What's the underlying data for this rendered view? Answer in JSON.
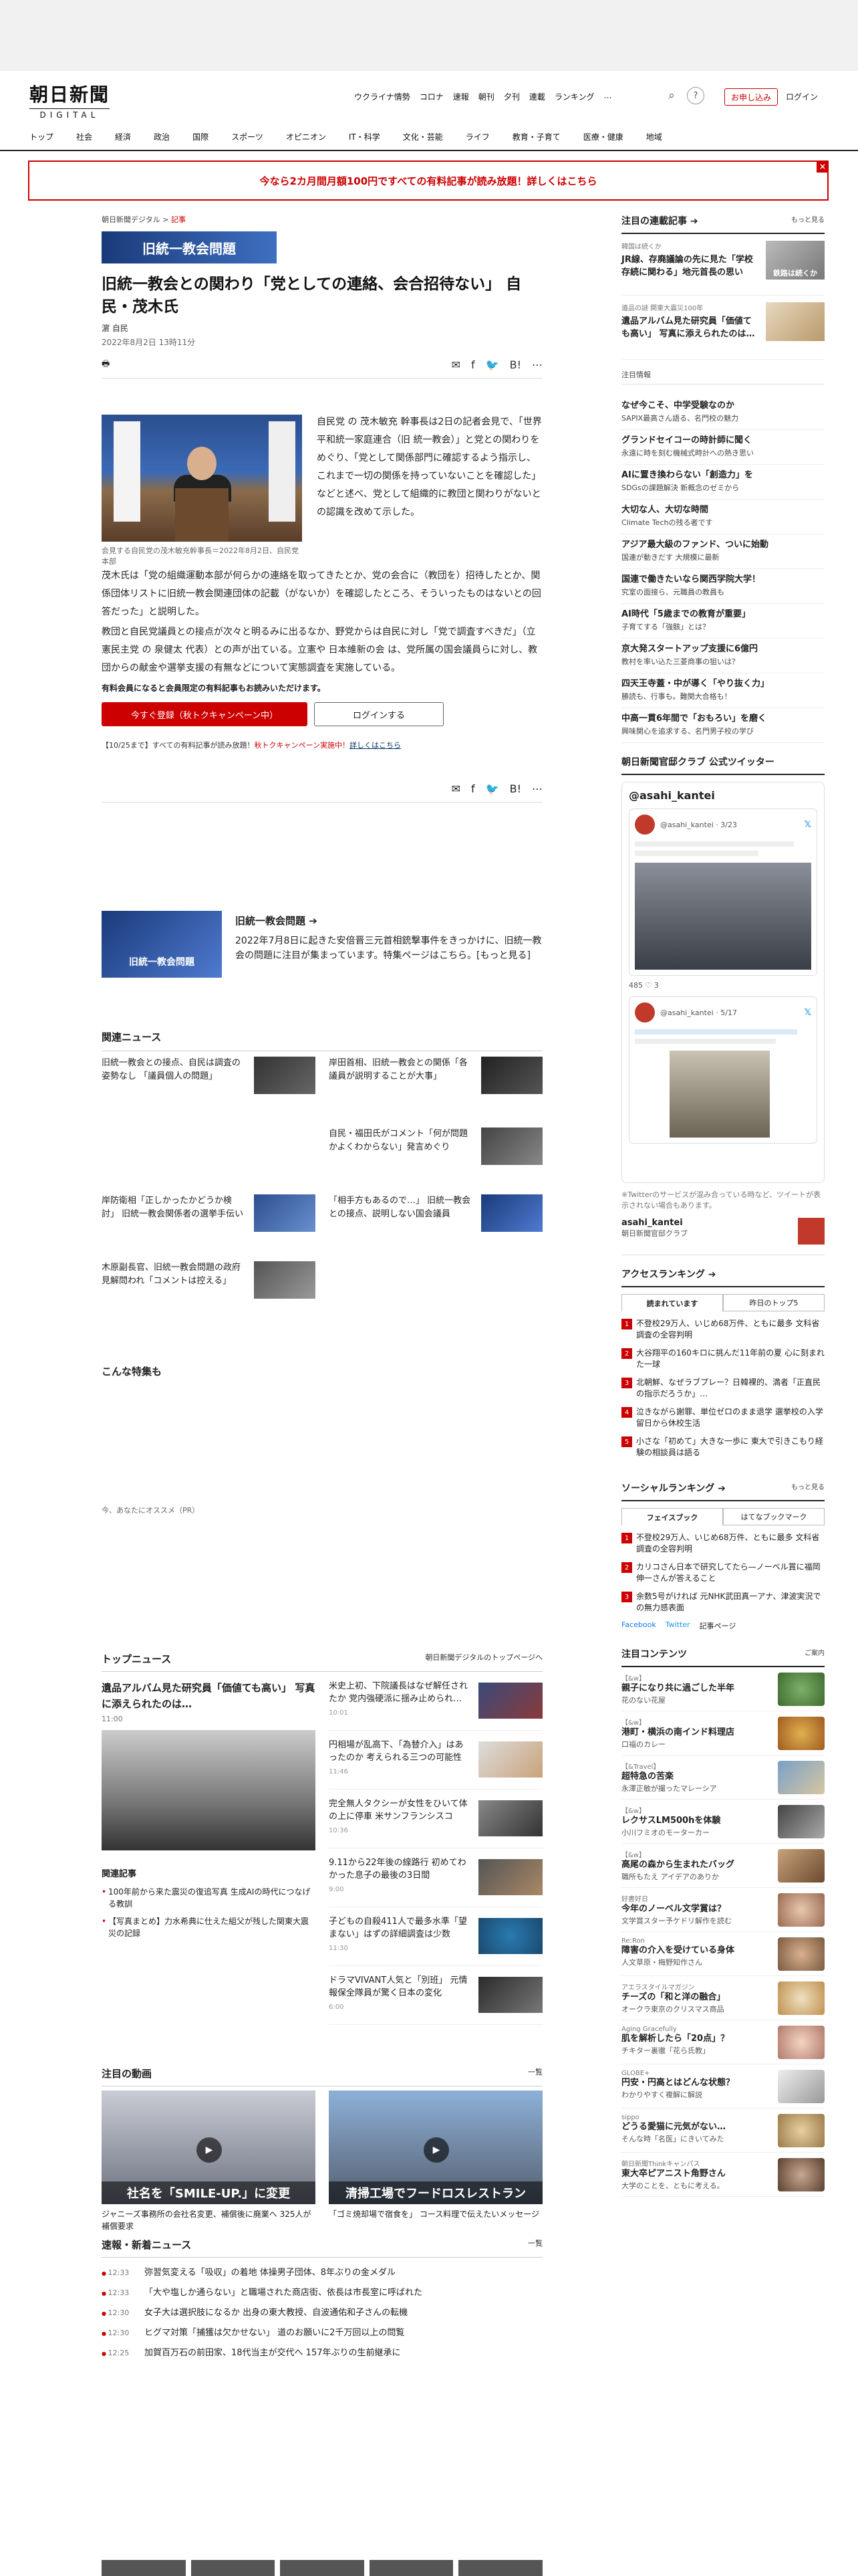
{
  "header": {
    "logo_ja": "朝日新聞",
    "logo_en": "DIGITAL",
    "topnav": [
      "ウクライナ情勢",
      "コロナ",
      "速報",
      "朝刊",
      "夕刊",
      "連載",
      "ランキング"
    ],
    "more": "…",
    "subscribe": "お申し込み",
    "login": "ログイン"
  },
  "catnav": [
    "トップ",
    "社会",
    "経済",
    "政治",
    "国際",
    "スポーツ",
    "オピニオン",
    "IT・科学",
    "文化・芸能",
    "ライフ",
    "教育・子育て",
    "医療・健康",
    "地域"
  ],
  "banner": {
    "text": "今なら2カ月間月額100円ですべての有料記事が読み放題！詳しくはこちら",
    "close": "×"
  },
  "article": {
    "breadcrumb": [
      "朝日新聞デジタル",
      "記事"
    ],
    "bc_sep": ">",
    "tag": "旧統一教会問題",
    "title": "旧統一教会との関わり「党としての連絡、会合招待ない」 自民・茂木氏",
    "author": "濵 自民",
    "date": "2022年8月2日 13時11分",
    "share_counts": {
      "list": "list",
      "one": "1"
    },
    "caption": "会見する自民党の茂木敏充幹事長＝2022年8月2日、自民党本部",
    "p1": "自民党 の 茂木敏充 幹事長は2日の記者会見で、「世界平和統一家庭連合（旧 統一教会）」と党との関わりをめぐり、「党として関係部門に確認するよう指示し、これまで一切の関係を持っていないことを確認した」などと述べ、党として組織的に教団と関わりがないとの認識を改めて示した。",
    "p2": "茂木氏は「党の組織運動本部が何らかの連絡を取ってきたとか、党の会合に（教団を）招待したとか、関係団体リストに旧統一教会関連団体の記載（がないか）を確認したところ、そういったものはないとの回答だった」と説明した。",
    "p3": "教団と自民党議員との接点が次々と明るみに出るなか、野党からは自民に対し「党で調査すべきだ」（立憲民主党 の 泉健太 代表）との声が出ている。立憲や 日本維新の会 は、党所属の国会議員らに対し、教団からの献金や選挙支援の有無などについて実態調査を実施している。",
    "member_text": "有料会員になると会員限定の有料記事もお読みいただけます。",
    "register": "今すぐ登録（秋トクキャンペーン中）",
    "login": "ログインする",
    "campaign_pre": "【10/25まで】すべての有料記事が読み放題！",
    "campaign_red": "秋トクキャンペーン実施中！",
    "campaign_post": "詳しくはこちら"
  },
  "feature": {
    "img_label": "旧統一教会問題",
    "title": "旧統一教会問題 ➔",
    "text": "2022年7月8日に起きた安倍晋三元首相銃撃事件をきっかけに、旧統一教会の問題に注目が集まっています。特集ページはこちら。[もっと見る]"
  },
  "related": {
    "heading": "関連ニュース",
    "items": [
      "旧統一教会との接点、自民は調査の姿勢なし 「議員個人の問題」",
      "岸田首相、旧統一教会との関係「各議員が説明することが大事」",
      "自民・福田氏がコメント「何が問題かよくわからない」発言めぐり",
      "岸防衛相「正しかったかどうか検討」 旧統一教会関係者の選挙手伝い",
      "「相手方もあるので…」 旧統一教会との接点、説明しない国会議員",
      "木原副長官、旧統一教会問題の政府見解問われ「コメントは控える」"
    ]
  },
  "konna": "こんな特集も",
  "osusume": "今、あなたにオススメ（PR）",
  "topnews": {
    "heading": "トップニュース",
    "link": "朝日新聞デジタルのトップページへ",
    "main_title": "遺品アルバム見た研究員「価値ても高い」 写真に添えられたのは…",
    "main_time": "11:00",
    "related_label": "関連記事",
    "related": [
      "100年前から来た震災の復追写真 生成AIの時代につなげる教訓",
      "【写真まとめ】力水希典に仕えた組父が残した関東大震災の記録"
    ],
    "right": [
      {
        "t": "米史上初、下院議長はなぜ解任されたか 党内強硬派に揺み止められ…",
        "tm": "10:01"
      },
      {
        "t": "円相場が乱高下、「為替介入」はあったのか 考えられる三つの可能性",
        "tm": "11:46"
      },
      {
        "t": "完全無人タクシーが女性をひいて体の上に停車 米サンフランシスコ",
        "tm": "10:36"
      },
      {
        "t": "9.11から22年後の線路行 初めてわかった息子の最後の3日間",
        "tm": "9:00"
      },
      {
        "t": "子どもの自殺411人で最多水準「望まない」はずの詳細調査は少数",
        "tm": "11:30"
      },
      {
        "t": "ドラマVIVANT人気と「別班」 元情報保全隊員が驚く日本の変化",
        "tm": "6:00"
      }
    ]
  },
  "video": {
    "heading": "注目の動画",
    "more": "一覧",
    "items": [
      {
        "cap": "ジャニーズ事務所の会社名変更、補償後に廃業へ 325人が補償要求",
        "overlay": "社名を「SMILE-UP.」に変更"
      },
      {
        "cap": "「ゴミ焼却場で宿食を」 コース料理で伝えたいメッセージ",
        "overlay": "清掃工場でフードロスレストラン"
      }
    ]
  },
  "flash": {
    "heading": "速報・新着ニュース",
    "more": "一覧",
    "items": [
      {
        "tm": "12:33",
        "t": "弥習気変える「吸収」の着地 体操男子団体、8年ぶりの金メダル"
      },
      {
        "tm": "12:33",
        "t": "「大や塩しか通らない」と職場された商店街、依長は市長室に呼ばれた"
      },
      {
        "tm": "12:30",
        "t": "女子大は選択肢になるか 出身の東大教授、自波通佑和子さんの転機"
      },
      {
        "tm": "12:30",
        "t": "ヒグマ対策「捕獲は欠かせない」 道のお願いに2千万回以上の問覧"
      },
      {
        "tm": "12:25",
        "t": "加賀百万石の前田家、18代当主が交代へ 157年ぶりの生前継承に"
      }
    ]
  },
  "side": {
    "chumoku_heading": "注目の連載記事 ➔",
    "more": "もっと見る",
    "chumoku": [
      {
        "sm": "韓国は続くか",
        "t": "JR線、存廃議論の先に見た「学校存続に関わる」地元首長の思い",
        "thumb": "鉄路は続くか"
      },
      {
        "sm": "遺品の謎 関東大震災100年",
        "t": "遺品アルバム見た研究員「価値ても高い」 写真に添えられたのは…"
      }
    ],
    "ad_label": "注目情報",
    "ads": [
      {
        "t": "なぜ今こそ、中学受験なのか",
        "s": "SAPIX最高さん語る、名門校の魅力"
      },
      {
        "t": "グランドセイコーの時計師に聞く",
        "s": "永遠に時を刻む機械式時計への熱き思い"
      },
      {
        "t": "AIに置き換わらない「創造力」を",
        "s": "SDGsの課題解決 新概念のゼミから"
      },
      {
        "t": "大切な人、大切な時間",
        "s": "Climate Techの残る者です"
      },
      {
        "t": "アジア最大級のファンド、ついに始動",
        "s": "国連が動きだす 大規模に最新"
      },
      {
        "t": "国連で働きたいなら関西学院大学！",
        "s": "究室の面接ら、元職員の教員も"
      },
      {
        "t": "AI時代「5歳までの教育が重要」",
        "s": "子育てする「強骸」とは？"
      },
      {
        "t": "京大発スタートアップ支援に6億円",
        "s": "教村を率い込た三菱商事の狙いは？"
      },
      {
        "t": "四天王寺蓋・中が導く「やり抜く力」",
        "s": "勝読も、行事も。難関大合格も！"
      },
      {
        "t": "中高一貫6年間で「おもろい」を磨く",
        "s": "興味関心を追求する、名門男子校の学び"
      }
    ],
    "club_heading": "朝日新聞官邸クラブ 公式ツイッター",
    "tw_title": "@asahi_kantei",
    "tw_handle": "@asahi_kantei · 3/23",
    "tw_handle2": "@asahi_kantei · 5/17",
    "tw_counts": "485 ♡  3",
    "tw_note": "※Twitterのサービスが混み合っている時など、ツイートが表示されない場合もあります。",
    "tw_account": "asahi_kantei",
    "tw_club": "朝日新聞官邸クラブ",
    "access_heading": "アクセスランキング ➔",
    "tabs": [
      "読まれています",
      "昨日のトップ5"
    ],
    "access": [
      "不登校29万人、いじめ68万件、ともに最多 文科省調査の全容判明",
      "大谷翔平の160キロに挑んだ11年前の夏 心に刻まれた一球",
      "北朝鮮、なぜラブプレー？日韓裸的、満者「正直民の指示だろうか」…",
      "泣きながら謝罪、単位ゼロのまま退学 選挙校の入学留日から休校生活",
      "小さな「初めて」大きな一歩に 東大で引きこもり経験の相談員は語る"
    ],
    "social_heading": "ソーシャルランキング ➔",
    "social_tabs": [
      "フェイスブック",
      "はてなブックマーク"
    ],
    "social": [
      "不登校29万人、いじめ68万件、ともに最多 文科省調査の全容判明",
      "カリコさん日本で研究してたら—ノーベル賞に福岡伸一さんが答えること",
      "余数5号がければ 元NHK武田真一アナ、津波実況での無力感表面"
    ],
    "social_links": [
      "Facebook",
      "Twitter",
      "記事ページ"
    ],
    "contents_heading": "注目コンテンツ",
    "contents_more": "ご案内",
    "contents": [
      {
        "sm": "【&w】",
        "t": "親子になり共に過ごした半年",
        "s": "花のない花屋"
      },
      {
        "sm": "【&w】",
        "t": "港町・横浜の南インド料理店",
        "s": "口福のカレー"
      },
      {
        "sm": "【&Travel】",
        "t": "超特急の苦楽",
        "s": "永澤正敏が撮ったマレーシア"
      },
      {
        "sm": "【&w】",
        "t": "レクサスLM500hを体験",
        "s": "小川フミオのモーターカー"
      },
      {
        "sm": "【&w】",
        "t": "高尾の森から生まれたバッグ",
        "s": "職所もたえ アイデアのありか"
      },
      {
        "sm": "好書好日",
        "t": "今年のノーベル文学賞は？",
        "s": "文学賞スター予ケドリ解作を読む"
      },
      {
        "sm": "Re:Ron",
        "t": "障害の介入を受けている身体",
        "s": "人文草原・梅野知作さん"
      },
      {
        "sm": "アエラスタイルマガジン",
        "t": "チーズの「和と洋の融合」",
        "s": "オークラ東京のクリスマス商品"
      },
      {
        "sm": "Aging Gracefully",
        "t": "肌を解析したら「20点」？",
        "s": "チキター裏徹「花ら氏教」"
      },
      {
        "sm": "GLOBE+",
        "t": "円安・円高とはどんな状態？",
        "s": "わかりやすく複解に解説"
      },
      {
        "sm": "sippo",
        "t": "どうる愛猫に元気がない…",
        "s": "そんな時「名医」にきいてみた"
      },
      {
        "sm": "朝日新聞Thinkキャンパス",
        "t": "東大卒ピアニスト角野さん",
        "s": "大学のことを、ともに考える。"
      }
    ]
  }
}
